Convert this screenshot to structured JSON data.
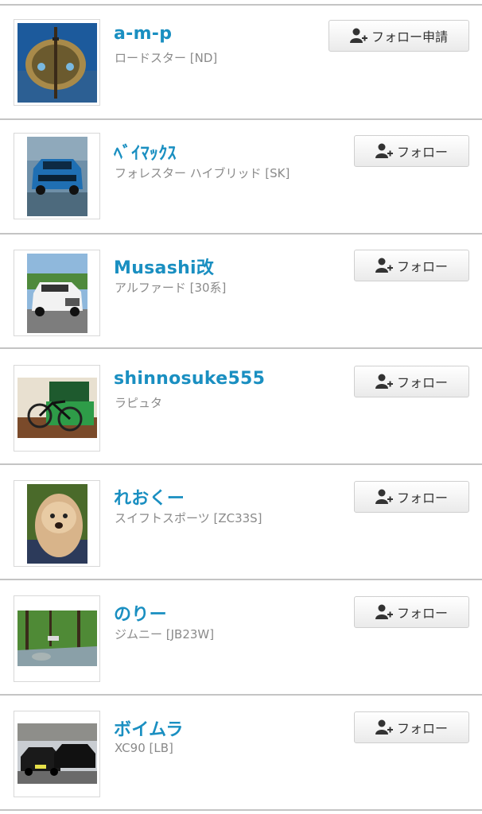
{
  "users": [
    {
      "name": "a-m-p",
      "car": "ロードスター [ND]",
      "button_label": "フォロー申請",
      "avatar": "golden-sculpture-photo"
    },
    {
      "name": "ﾍﾞｲﾏｯｸｽ",
      "car": "フォレスター ハイブリッド [SK]",
      "button_label": "フォロー",
      "avatar": "blue-suv-photo"
    },
    {
      "name": "Musashi改",
      "car": "アルファード [30系]",
      "button_label": "フォロー",
      "avatar": "white-minivan-photo"
    },
    {
      "name": "shinnosuke555",
      "car": "ラピュタ",
      "button_label": "フォロー",
      "avatar": "bicycle-photo"
    },
    {
      "name": "れおくー",
      "car": "スイフトスポーツ [ZC33S]",
      "button_label": "フォロー",
      "avatar": "dog-photo"
    },
    {
      "name": "のりー",
      "car": "ジムニー [JB23W]",
      "button_label": "フォロー",
      "avatar": "forest-stream-photo"
    },
    {
      "name": "ボイムラ",
      "car": "XC90 [LB]",
      "button_label": "フォロー",
      "avatar": "parked-cars-photo"
    }
  ],
  "colors": {
    "name": "#1a8fc1",
    "meta": "#8a8a8a",
    "divider": "#c4c4c4"
  }
}
